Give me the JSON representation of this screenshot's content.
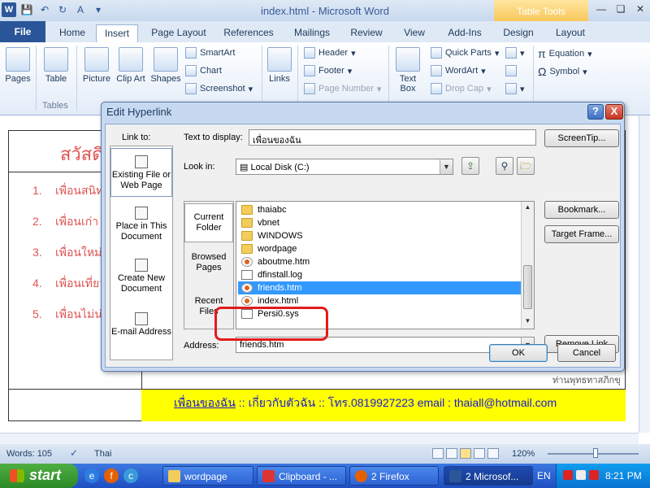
{
  "window": {
    "title": "index.html - Microsoft Word",
    "context_tab_group": "Table Tools"
  },
  "ribbon": {
    "tabs": [
      {
        "label": "File"
      },
      {
        "label": "Home"
      },
      {
        "label": "Insert"
      },
      {
        "label": "Page Layout"
      },
      {
        "label": "References"
      },
      {
        "label": "Mailings"
      },
      {
        "label": "Review"
      },
      {
        "label": "View"
      },
      {
        "label": "Add-Ins"
      },
      {
        "label": "Design"
      },
      {
        "label": "Layout"
      }
    ],
    "buttons": {
      "pages": "Pages",
      "table": "Table",
      "picture": "Picture",
      "clip_art": "Clip Art",
      "shapes": "Shapes",
      "smartart": "SmartArt",
      "chart": "Chart",
      "screenshot": "Screenshot",
      "links": "Links",
      "header": "Header",
      "footer": "Footer",
      "page_number": "Page Number",
      "text_box": "Text Box",
      "quick_parts": "Quick Parts",
      "wordart": "WordArt",
      "drop_cap": "Drop Cap",
      "equation": "Equation",
      "symbol": "Symbol"
    },
    "groups": {
      "tables": "Tables"
    }
  },
  "document": {
    "heading": "สวัสดี",
    "items": [
      {
        "num": "1.",
        "text": "เพื่อนสนิท"
      },
      {
        "num": "2.",
        "text": "เพื่อนเก่า"
      },
      {
        "num": "3.",
        "text": "เพื่อนใหม่"
      },
      {
        "num": "4.",
        "text": "เพื่อนเที่ยว"
      },
      {
        "num": "5.",
        "text": "เพื่อนไม่น่า"
      }
    ],
    "signature": "ท่านพุทธทาสภิกขุ",
    "footer": {
      "link": "เพื่อนของฉัน",
      "sep1": " :: ",
      "about": "เกี่ยวกับตัวฉัน",
      "sep2": " :: ",
      "phone": "โทร.0819927223",
      "email": "  email : thaiall@hotmail.com"
    }
  },
  "dialog": {
    "title": "Edit Hyperlink",
    "help": "?",
    "close": "X",
    "link_to_label": "Link to:",
    "link_to_items": [
      {
        "label": "Existing File or Web Page"
      },
      {
        "label": "Place in This Document"
      },
      {
        "label": "Create New Document"
      },
      {
        "label": "E-mail Address"
      }
    ],
    "text_to_display_label": "Text to display:",
    "text_to_display_value": "เพื่อนของฉัน",
    "screentip_button": "ScreenTip...",
    "look_in_label": "Look in:",
    "look_in_value": "Local Disk (C:)",
    "subnav": [
      {
        "label": "Current Folder"
      },
      {
        "label": "Browsed Pages"
      },
      {
        "label": "Recent Files"
      }
    ],
    "files": [
      {
        "name": "thaiabc",
        "type": "folder"
      },
      {
        "name": "vbnet",
        "type": "folder"
      },
      {
        "name": "WINDOWS",
        "type": "folder"
      },
      {
        "name": "wordpage",
        "type": "folder"
      },
      {
        "name": "aboutme.htm",
        "type": "html"
      },
      {
        "name": "dfinstall.log",
        "type": "doc"
      },
      {
        "name": "friends.htm",
        "type": "html",
        "selected": true
      },
      {
        "name": "index.html",
        "type": "html"
      },
      {
        "name": "Persi0.sys",
        "type": "doc"
      }
    ],
    "bookmark_button": "Bookmark...",
    "target_frame_button": "Target Frame...",
    "address_label": "Address:",
    "address_value": "friends.htm",
    "remove_link_button": "Remove Link",
    "ok_button": "OK",
    "cancel_button": "Cancel"
  },
  "statusbar": {
    "words": "Words: 105",
    "language": "Thai",
    "zoom": "120%"
  },
  "taskbar": {
    "start": "start",
    "items": [
      {
        "label": "wordpage"
      },
      {
        "label": "Clipboard - ..."
      },
      {
        "label": "2 Firefox"
      },
      {
        "label": "2 Microsof..."
      }
    ],
    "language": "EN",
    "time": "8:21 PM"
  },
  "colors": {
    "file_tab": "#2a5699",
    "doc_text_red": "#e05353",
    "footer_yellow": "#ffff00",
    "footer_link_blue": "#1a1ad6",
    "selection_blue": "#3399ff",
    "annotation_red": "#e21b1b"
  }
}
